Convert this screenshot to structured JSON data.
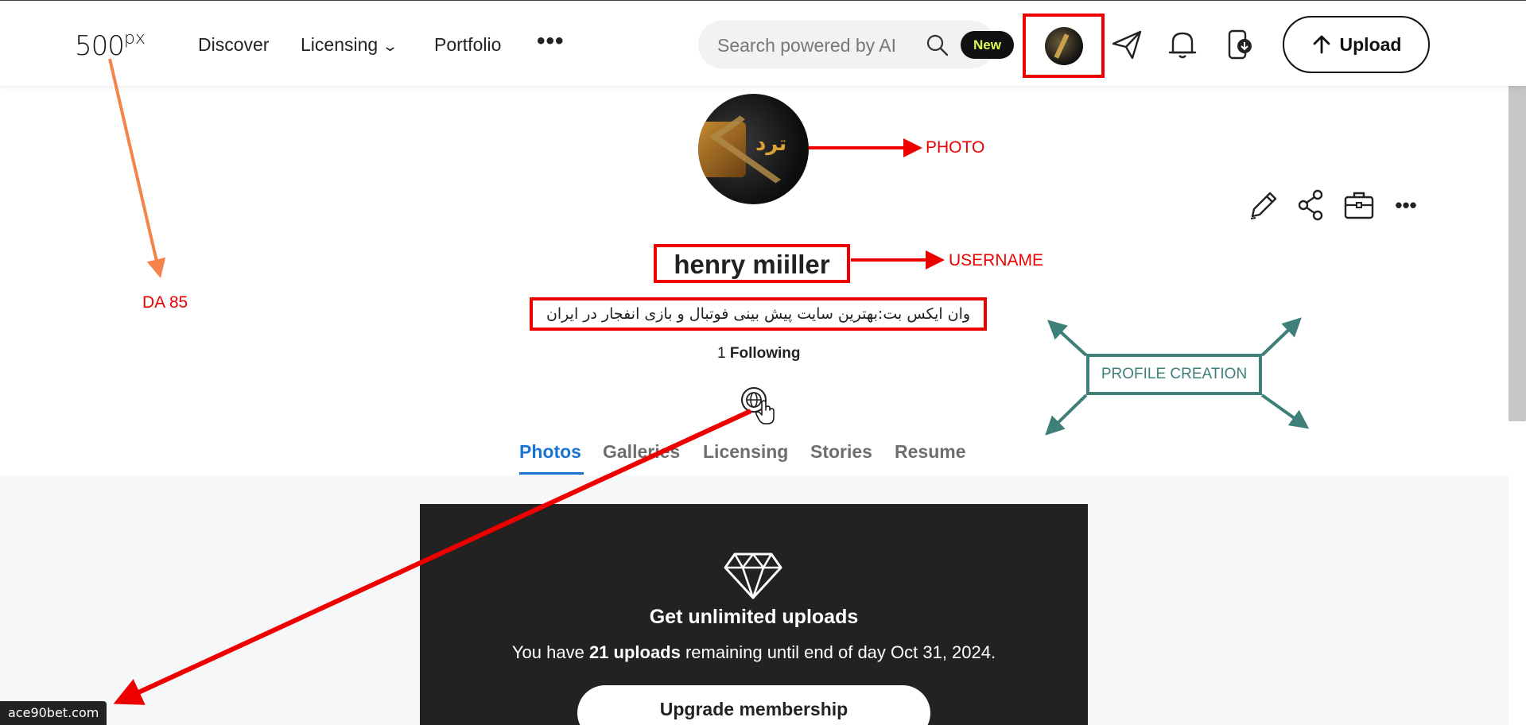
{
  "header": {
    "logo": "500",
    "logo_sup": "px",
    "nav": {
      "discover": "Discover",
      "licensing": "Licensing",
      "portfolio": "Portfolio",
      "more": "•••"
    },
    "search": {
      "placeholder": "Search powered by AI",
      "badge": "New"
    },
    "upload_label": "Upload"
  },
  "profile": {
    "username": "henry miiller",
    "bio": "وان ایکس بت:بهترین سایت پیش بینی فوتبال و بازی انفجار در ایران",
    "following_count": "1",
    "following_label": "Following",
    "photo_text": "ترد"
  },
  "tabs": [
    {
      "label": "Photos",
      "active": true
    },
    {
      "label": "Galleries",
      "active": false
    },
    {
      "label": "Licensing",
      "active": false
    },
    {
      "label": "Stories",
      "active": false
    },
    {
      "label": "Resume",
      "active": false
    }
  ],
  "upsell": {
    "title": "Get unlimited uploads",
    "text_prefix": "You have ",
    "text_count": "21 uploads",
    "text_suffix": " remaining until end of day Oct 31, 2024.",
    "button": "Upgrade membership"
  },
  "status_url": "ace90bet.com",
  "annotations": {
    "photo": "PHOTO",
    "username": "USERNAME",
    "da": "DA 85",
    "profile_creation": "PROFILE CREATION"
  },
  "colors": {
    "accent_blue": "#1a73d0",
    "annotation_red": "#ee0000",
    "annotation_orange": "#f5844b",
    "annotation_teal": "#3f7f7a",
    "badge_text": "#d8f94c"
  },
  "icons": [
    "search-icon",
    "send-icon",
    "bell-icon",
    "download-icon",
    "upload-arrow-icon",
    "edit-icon",
    "share-icon",
    "briefcase-icon",
    "more-icon",
    "globe-icon",
    "diamond-icon",
    "chevron-down-icon"
  ]
}
